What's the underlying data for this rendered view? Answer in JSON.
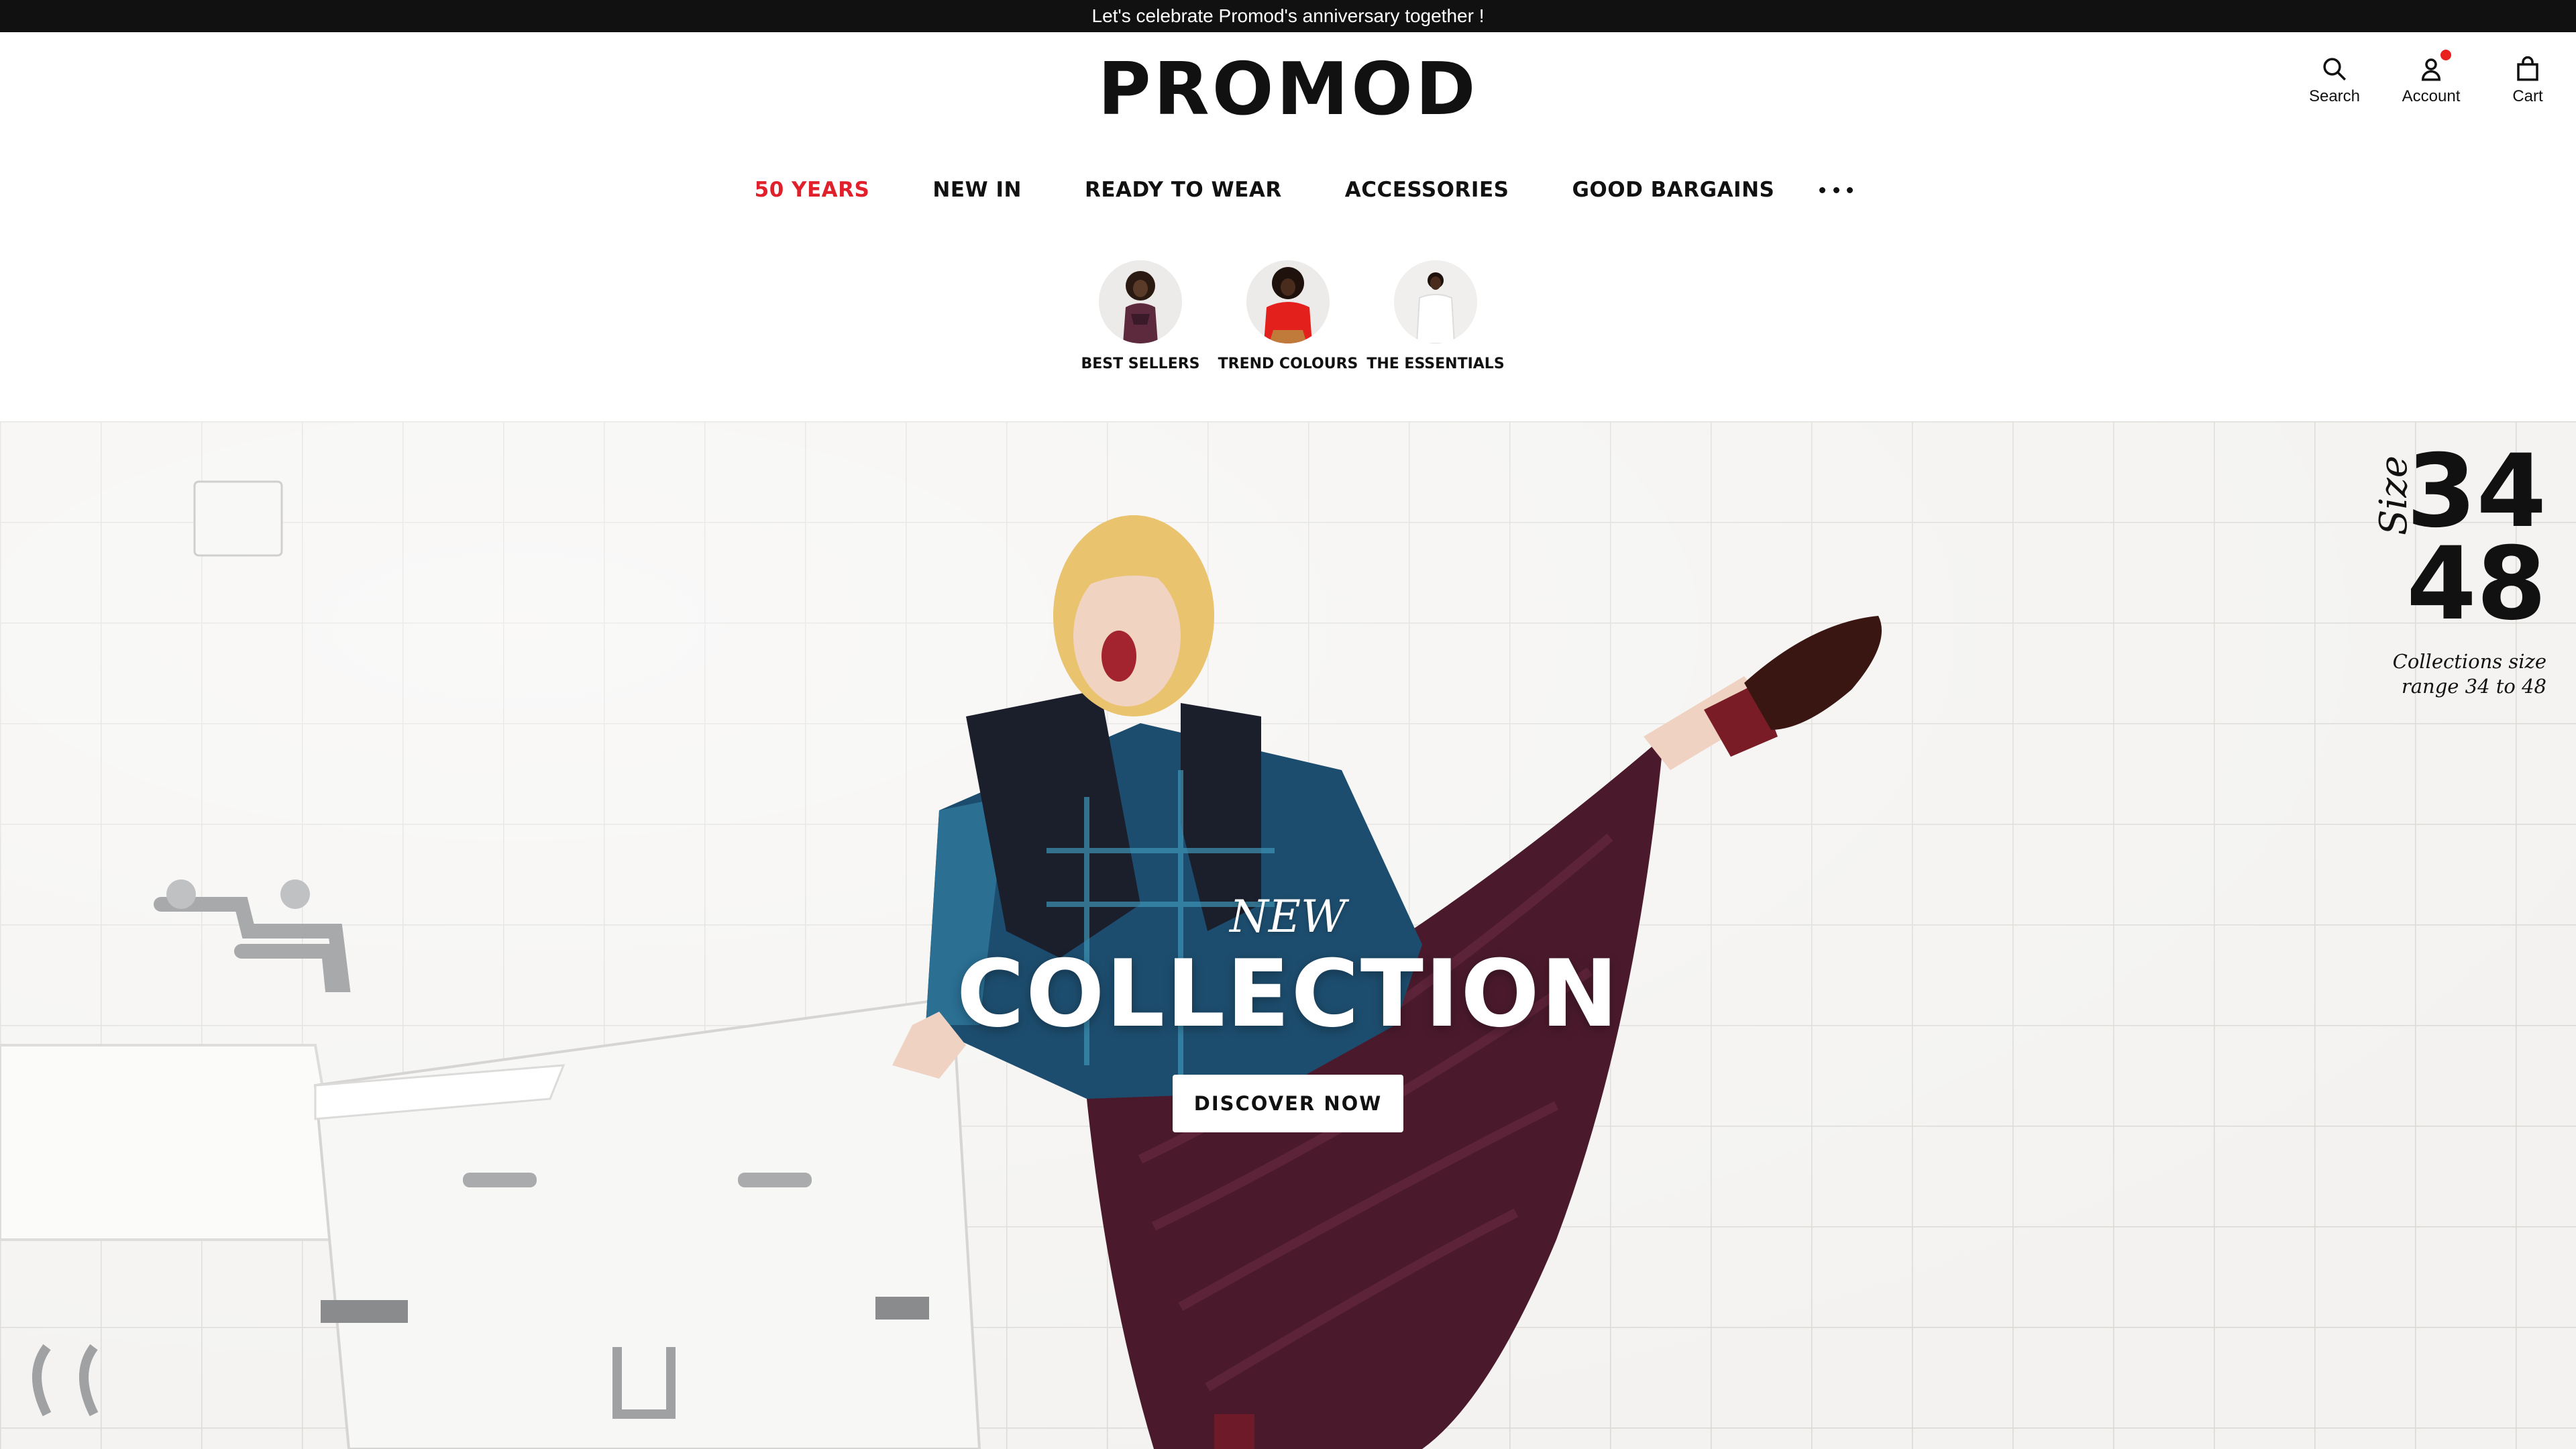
{
  "announcement": "Let's celebrate Promod's anniversary together !",
  "brand": {
    "logo_text": "PROMOD"
  },
  "header_tools": [
    {
      "label": "Search",
      "icon": "search-icon"
    },
    {
      "label": "Account",
      "icon": "user-icon",
      "has_notification": true
    },
    {
      "label": "Cart",
      "icon": "bag-icon"
    }
  ],
  "nav": [
    {
      "label": "50 YEARS",
      "accent": true
    },
    {
      "label": "NEW IN"
    },
    {
      "label": "READY TO WEAR"
    },
    {
      "label": "ACCESSORIES"
    },
    {
      "label": "GOOD BARGAINS"
    }
  ],
  "nav_more_icon": "more-dots-icon",
  "categories": [
    {
      "label": "BEST SELLERS"
    },
    {
      "label": "TREND COLOURS"
    },
    {
      "label": "THE ESSENTIALS"
    }
  ],
  "hero": {
    "eyebrow": "NEW",
    "title": "COLLECTION",
    "cta": "DISCOVER NOW"
  },
  "size_badge": {
    "word": "Size",
    "min": "34",
    "max": "48",
    "caption_line1": "Collections size",
    "caption_line2": "range 34 to 48"
  },
  "colors": {
    "accent": "#e0202a",
    "topbar": "#111111",
    "notification": "#e8211e"
  }
}
